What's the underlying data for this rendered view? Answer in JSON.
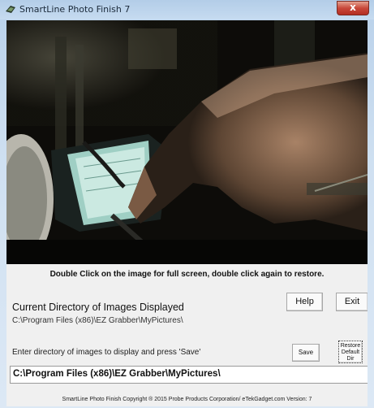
{
  "window": {
    "title": "SmartLine Photo Finish 7",
    "close_label": "x"
  },
  "photo": {
    "description_icon": "camera-frame-image",
    "caption": "Double Click on the image for full screen, double click again  to restore."
  },
  "current_directory": {
    "heading": "Current Directory of Images Displayed",
    "path": "C:\\Program Files (x86)\\EZ Grabber\\MyPictures\\"
  },
  "buttons": {
    "help": "Help",
    "exit": "Exit",
    "save": "Save",
    "restore_line1": "Restore",
    "restore_line2": "Default",
    "restore_line3": "Dir"
  },
  "directory_entry": {
    "label": "Enter directory of images to display and press 'Save'",
    "value": "C:\\Program Files (x86)\\EZ Grabber\\MyPictures\\"
  },
  "footer": {
    "text": "SmartLine Photo Finish Copyright ® 2015 Probe Products Corporation/ eTekGadget.com  Version:  7"
  },
  "colors": {
    "titlebar": "#c6dbf0",
    "close": "#c8483a",
    "client_bg": "#f0f0f0"
  }
}
